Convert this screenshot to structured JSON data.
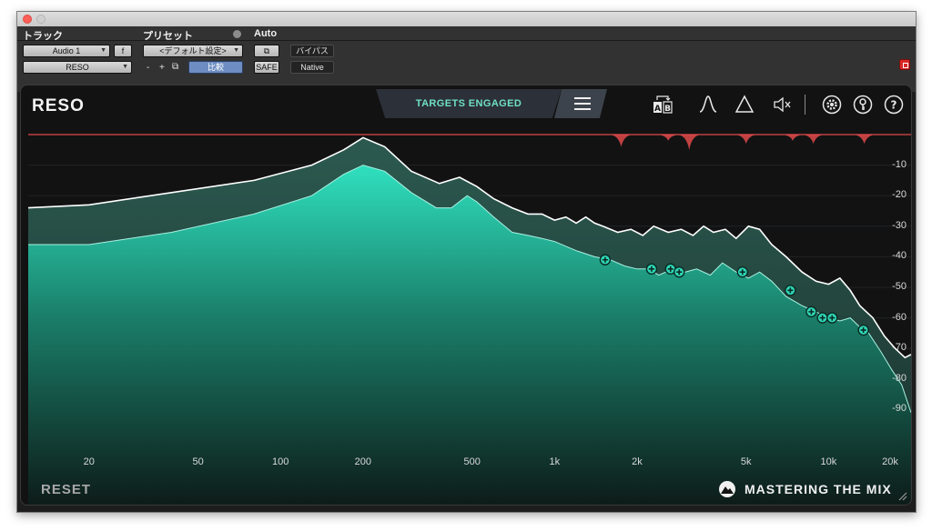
{
  "host": {
    "labels": {
      "track": "トラック",
      "preset": "プリセット",
      "auto": "Auto"
    },
    "track_name": "Audio 1",
    "track_f": "f",
    "plugin_name": "RESO",
    "preset_value": "<デフォルト設定>",
    "compare_label": "比較",
    "minus": "-",
    "plus": "+",
    "safe_label": "SAFE",
    "bypass_label": "バイパス",
    "native_label": "Native"
  },
  "plugin": {
    "logo": "RESO",
    "targets_label": "TARGETS ENGAGED",
    "reset_label": "RESET",
    "brand": "MASTERING THE MIX",
    "accent": "#2fd6b5",
    "alert_color": "#e04a4a"
  },
  "chart_data": {
    "type": "area",
    "x_unit": "Hz",
    "x_ticks": [
      {
        "v": 20,
        "label": "20"
      },
      {
        "v": 50,
        "label": "50"
      },
      {
        "v": 100,
        "label": "100"
      },
      {
        "v": 200,
        "label": "200"
      },
      {
        "v": 500,
        "label": "500"
      },
      {
        "v": 1000,
        "label": "1k"
      },
      {
        "v": 2000,
        "label": "2k"
      },
      {
        "v": 5000,
        "label": "5k"
      },
      {
        "v": 10000,
        "label": "10k"
      },
      {
        "v": 20000,
        "label": "20k"
      }
    ],
    "y_ticks": [
      {
        "v": -10,
        "label": "-10"
      },
      {
        "v": -20,
        "label": "-20"
      },
      {
        "v": -30,
        "label": "-30"
      },
      {
        "v": -40,
        "label": "-40"
      },
      {
        "v": -50,
        "label": "-50"
      },
      {
        "v": -60,
        "label": "-60"
      },
      {
        "v": -70,
        "label": "-70"
      },
      {
        "v": -80,
        "label": "-80"
      },
      {
        "v": -90,
        "label": "-90"
      }
    ],
    "ylim": [
      -100,
      0
    ],
    "xlim": [
      12,
      20000
    ],
    "series": [
      {
        "role": "spectrum-peak",
        "points": [
          [
            12,
            -24
          ],
          [
            20,
            -23
          ],
          [
            40,
            -19
          ],
          [
            80,
            -15
          ],
          [
            130,
            -10
          ],
          [
            170,
            -5
          ],
          [
            200,
            -1
          ],
          [
            240,
            -4
          ],
          [
            300,
            -12
          ],
          [
            380,
            -16
          ],
          [
            450,
            -14
          ],
          [
            520,
            -17
          ],
          [
            600,
            -21
          ],
          [
            700,
            -24
          ],
          [
            800,
            -26
          ],
          [
            900,
            -26
          ],
          [
            1000,
            -28
          ],
          [
            1100,
            -27
          ],
          [
            1200,
            -29
          ],
          [
            1300,
            -27
          ],
          [
            1400,
            -29
          ],
          [
            1500,
            -30
          ],
          [
            1700,
            -32
          ],
          [
            1900,
            -31
          ],
          [
            2100,
            -33
          ],
          [
            2300,
            -30
          ],
          [
            2600,
            -32
          ],
          [
            2900,
            -31
          ],
          [
            3200,
            -33
          ],
          [
            3500,
            -30
          ],
          [
            3800,
            -32
          ],
          [
            4200,
            -31
          ],
          [
            4600,
            -34
          ],
          [
            5100,
            -30
          ],
          [
            5600,
            -31
          ],
          [
            6200,
            -36
          ],
          [
            7000,
            -40
          ],
          [
            8000,
            -45
          ],
          [
            9000,
            -48
          ],
          [
            10000,
            -49
          ],
          [
            11000,
            -47
          ],
          [
            12000,
            -51
          ],
          [
            13000,
            -56
          ],
          [
            14500,
            -60
          ],
          [
            16000,
            -66
          ],
          [
            17500,
            -70
          ],
          [
            19000,
            -73
          ],
          [
            20000,
            -72
          ]
        ]
      },
      {
        "role": "spectrum-fill",
        "points": [
          [
            12,
            -36
          ],
          [
            20,
            -36
          ],
          [
            40,
            -32
          ],
          [
            80,
            -26
          ],
          [
            130,
            -20
          ],
          [
            170,
            -13
          ],
          [
            200,
            -10
          ],
          [
            240,
            -12
          ],
          [
            300,
            -19
          ],
          [
            370,
            -24
          ],
          [
            420,
            -24
          ],
          [
            480,
            -20
          ],
          [
            520,
            -22
          ],
          [
            600,
            -27
          ],
          [
            700,
            -32
          ],
          [
            800,
            -33
          ],
          [
            900,
            -34
          ],
          [
            1000,
            -35
          ],
          [
            1200,
            -38
          ],
          [
            1400,
            -40
          ],
          [
            1600,
            -41
          ],
          [
            1800,
            -43
          ],
          [
            2000,
            -44
          ],
          [
            2200,
            -44
          ],
          [
            2400,
            -46
          ],
          [
            2700,
            -44
          ],
          [
            3000,
            -45
          ],
          [
            3300,
            -44
          ],
          [
            3700,
            -46
          ],
          [
            4100,
            -42
          ],
          [
            4600,
            -45
          ],
          [
            5100,
            -47
          ],
          [
            5600,
            -45
          ],
          [
            6200,
            -48
          ],
          [
            7000,
            -53
          ],
          [
            8000,
            -56
          ],
          [
            9000,
            -58
          ],
          [
            10000,
            -60
          ],
          [
            11000,
            -61
          ],
          [
            12000,
            -60
          ],
          [
            13000,
            -63
          ],
          [
            14000,
            -65
          ],
          [
            15500,
            -71
          ],
          [
            17000,
            -77
          ],
          [
            18500,
            -82
          ],
          [
            20000,
            -91
          ]
        ]
      }
    ],
    "ceiling_db": 0,
    "resonance_dips": [
      {
        "f": 1750,
        "depth": 4
      },
      {
        "f": 2600,
        "depth": 2
      },
      {
        "f": 3100,
        "depth": 5
      },
      {
        "f": 5000,
        "depth": 3
      },
      {
        "f": 7400,
        "depth": 2
      },
      {
        "f": 8800,
        "depth": 3
      },
      {
        "f": 13500,
        "depth": 3
      }
    ],
    "nodes": [
      {
        "f": 1530,
        "db": -41
      },
      {
        "f": 2260,
        "db": -44
      },
      {
        "f": 2650,
        "db": -44
      },
      {
        "f": 2850,
        "db": -45
      },
      {
        "f": 4850,
        "db": -45
      },
      {
        "f": 7250,
        "db": -51
      },
      {
        "f": 8650,
        "db": -58
      },
      {
        "f": 9500,
        "db": -60
      },
      {
        "f": 10300,
        "db": -60
      },
      {
        "f": 13400,
        "db": -64
      }
    ]
  }
}
